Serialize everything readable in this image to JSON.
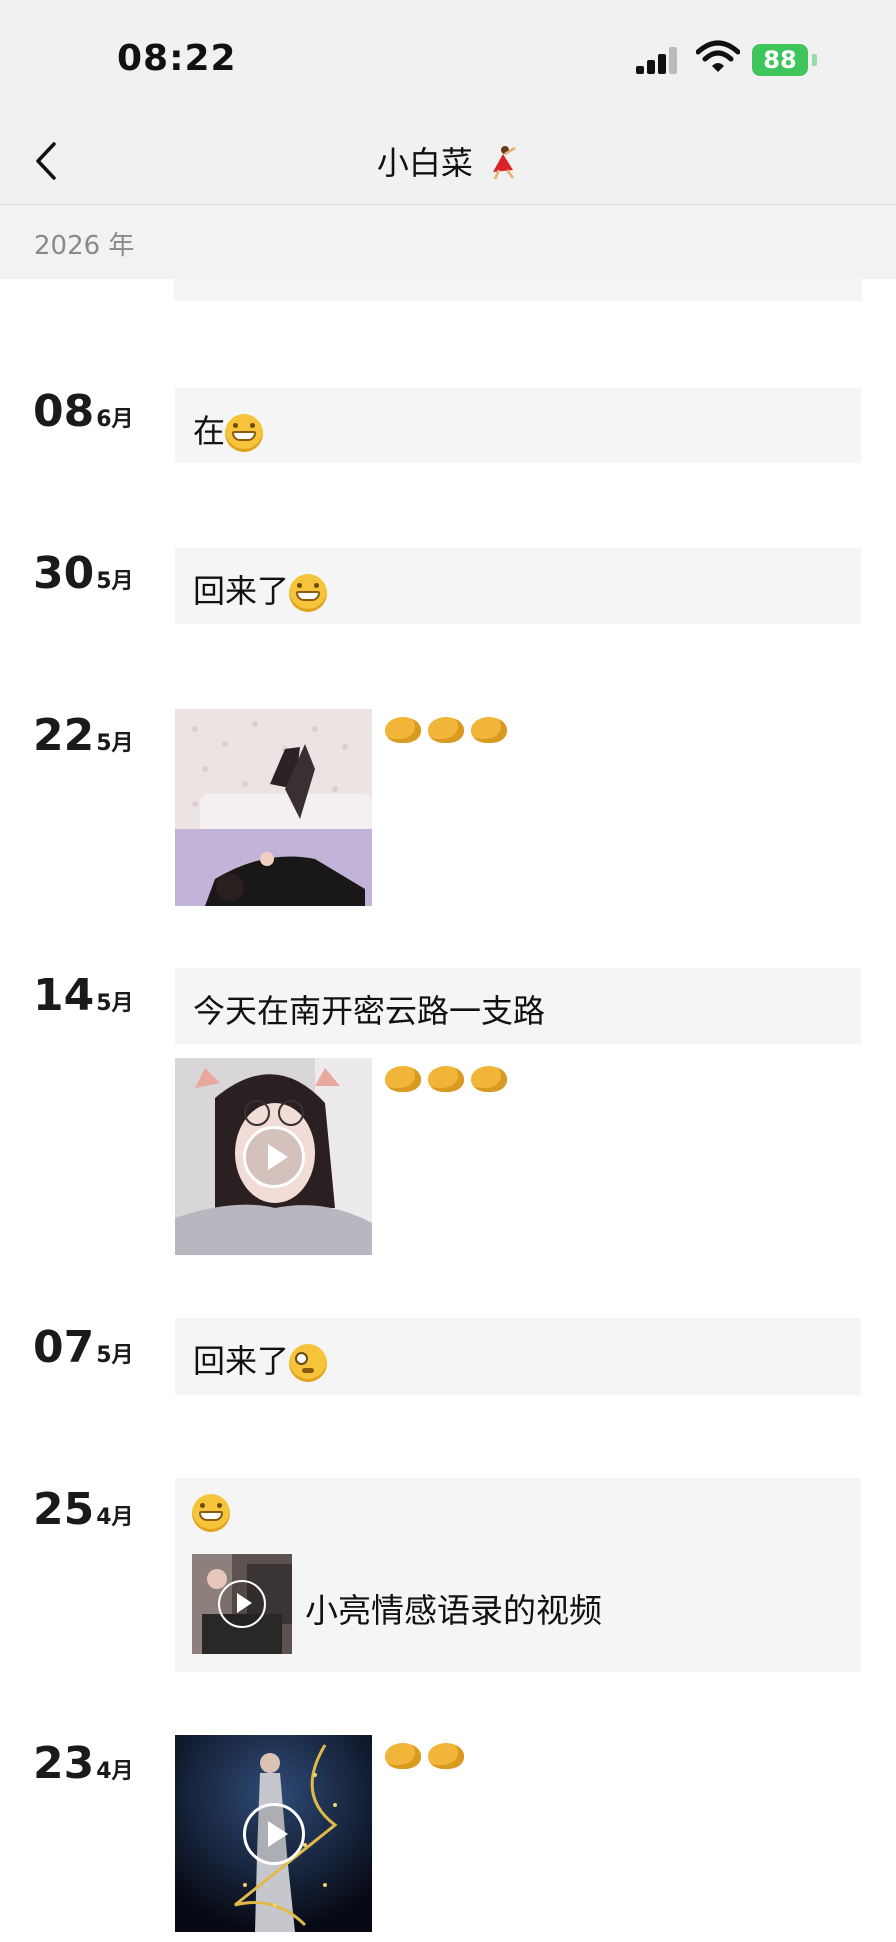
{
  "status_bar": {
    "time": "08:22",
    "battery": "88"
  },
  "header": {
    "title": "小白菜"
  },
  "year_label": "2026 年",
  "posts": [
    {
      "day": "08",
      "month": "6月",
      "text": "在"
    },
    {
      "day": "30",
      "month": "5月",
      "text": "回来了"
    },
    {
      "day": "22",
      "month": "5月"
    },
    {
      "day": "14",
      "month": "5月",
      "text": "今天在南开密云路一支路"
    },
    {
      "day": "07",
      "month": "5月",
      "text": "回来了"
    },
    {
      "day": "25",
      "month": "4月",
      "share_title": "小亮情感语录的视频"
    },
    {
      "day": "23",
      "month": "4月"
    }
  ],
  "icons": {
    "back": "chevron-left-icon",
    "grin": "grinning-emoji-icon",
    "dizzy": "dizzy-face-emoji-icon",
    "clap": "clapping-hands-emoji-icon",
    "play": "play-icon"
  },
  "colors": {
    "battery": "#3ec55b",
    "entry_bg": "#f5f5f5",
    "header_bg": "#f1f1f1"
  }
}
